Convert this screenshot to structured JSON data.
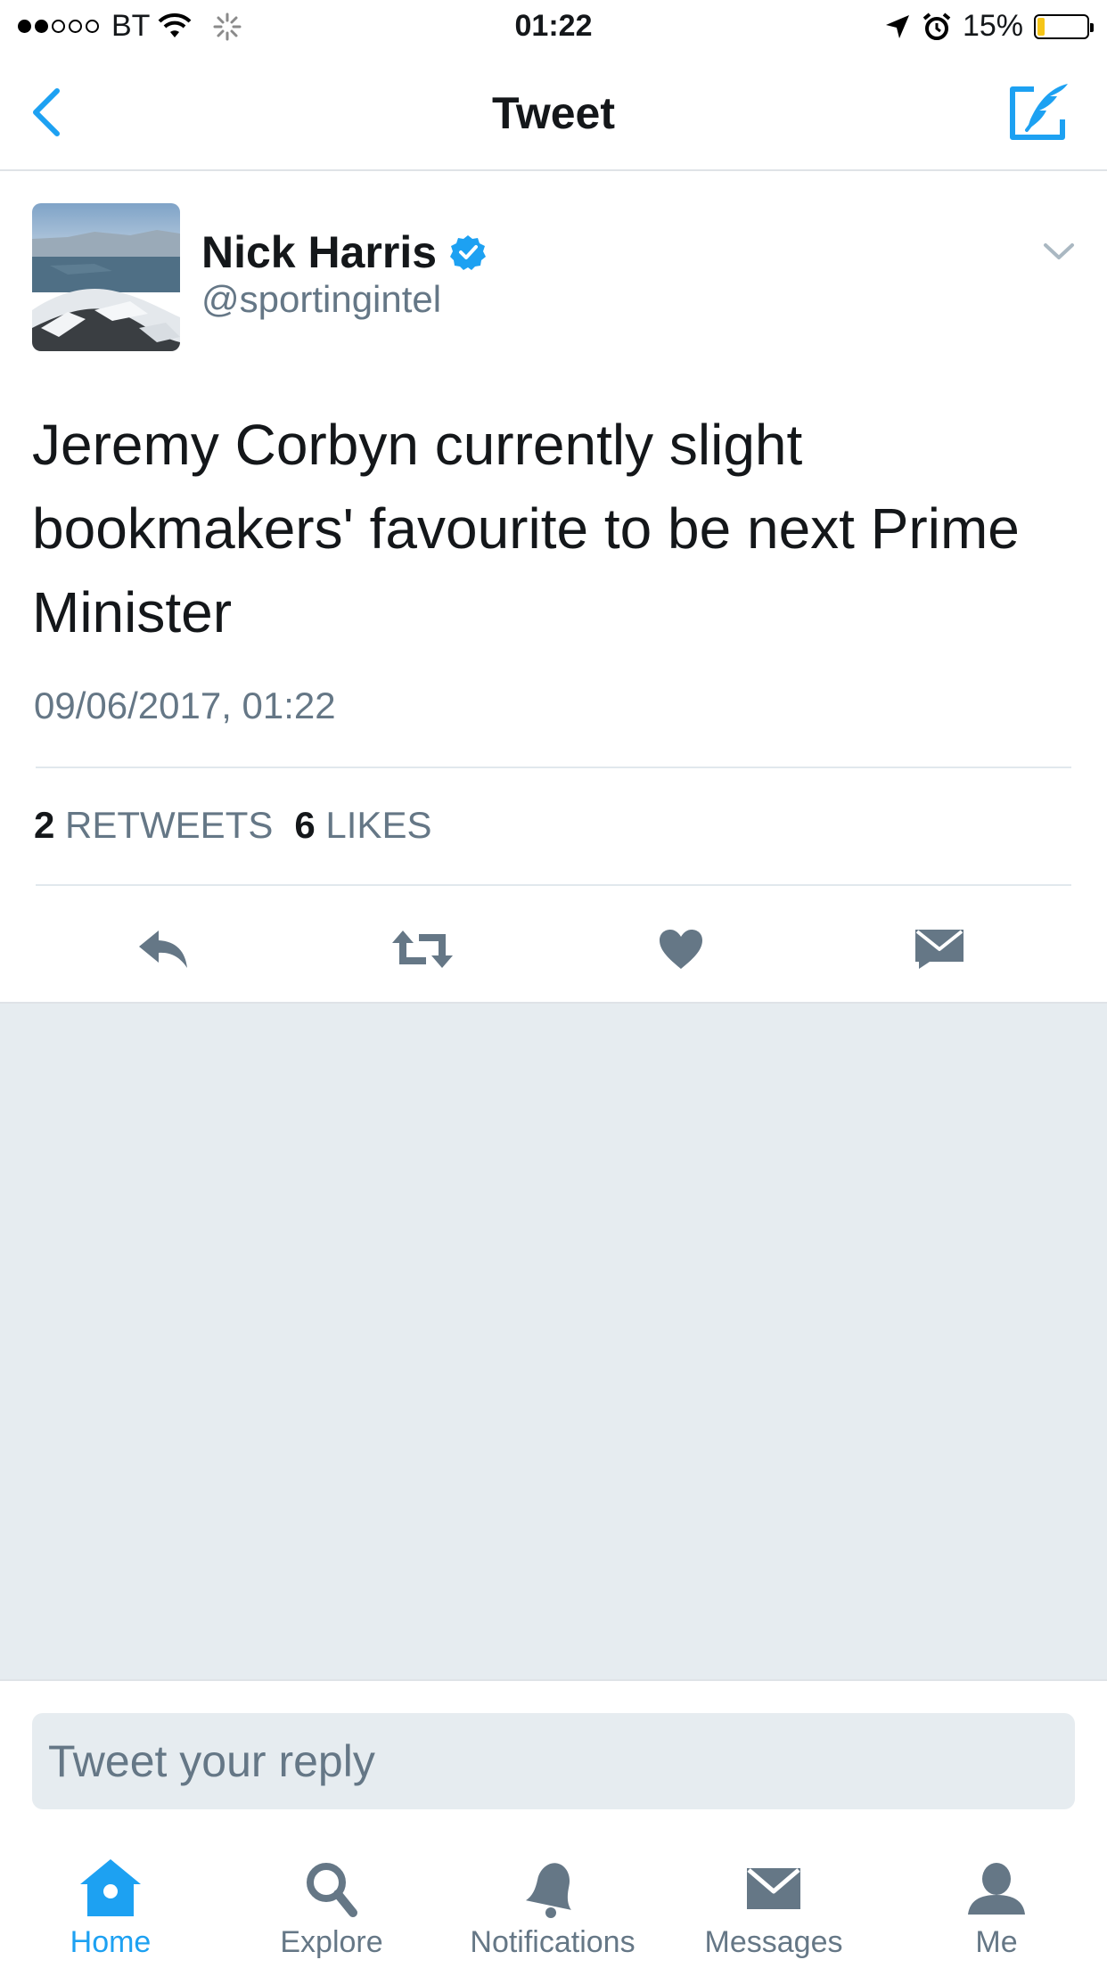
{
  "status_bar": {
    "carrier": "BT",
    "time": "01:22",
    "battery_percent": "15%",
    "battery_level": 0.15
  },
  "nav": {
    "title": "Tweet"
  },
  "tweet": {
    "author_name": "Nick Harris",
    "author_handle": "@sportingintel",
    "text": "Jeremy Corbyn currently slight bookmakers' favourite to be next Prime Minister",
    "timestamp": "09/06/2017, 01:22",
    "retweets_count": "2",
    "retweets_label": "RETWEETS",
    "likes_count": "6",
    "likes_label": "LIKES"
  },
  "reply": {
    "placeholder": "Tweet your reply"
  },
  "tab_bar": {
    "tabs": [
      {
        "label": "Home"
      },
      {
        "label": "Explore"
      },
      {
        "label": "Notifications"
      },
      {
        "label": "Messages"
      },
      {
        "label": "Me"
      }
    ]
  },
  "colors": {
    "accent": "#1da1f2",
    "secondary_text": "#657786",
    "icon_grey": "#657786",
    "background_grey": "#e6ecf0"
  },
  "icons": [
    "back-icon",
    "compose-icon",
    "verified-icon",
    "chevron-down-icon",
    "reply-icon",
    "retweet-icon",
    "like-icon",
    "direct-message-icon",
    "home-icon",
    "search-icon",
    "bell-icon",
    "envelope-icon",
    "person-icon"
  ]
}
